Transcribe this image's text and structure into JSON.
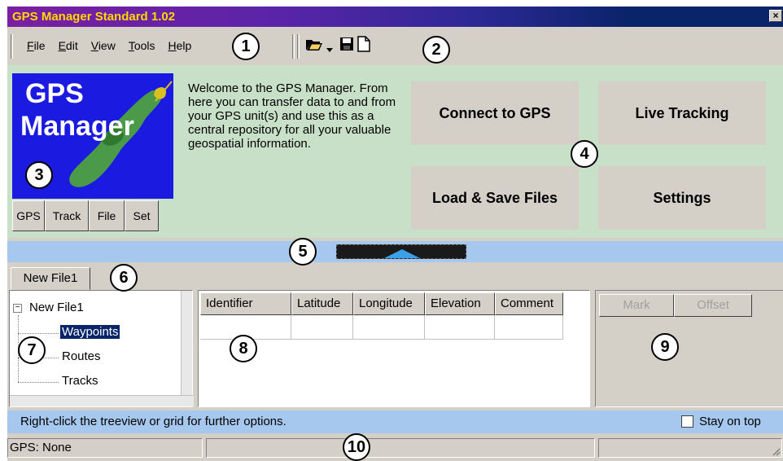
{
  "window": {
    "title": "GPS Manager Standard 1.02",
    "close_label": "×"
  },
  "menu": {
    "items": [
      {
        "label": "File",
        "accel": "F",
        "rest": "ile"
      },
      {
        "label": "Edit",
        "accel": "E",
        "rest": "dit"
      },
      {
        "label": "View",
        "accel": "V",
        "rest": "iew"
      },
      {
        "label": "Tools",
        "accel": "T",
        "rest": "ools"
      },
      {
        "label": "Help",
        "accel": "H",
        "rest": "elp"
      }
    ]
  },
  "toolbar": {
    "open_icon": "folder-open-icon",
    "dropdown_icon": "dropdown-arrow-icon",
    "save_icon": "floppy-disk-icon",
    "new_icon": "new-document-icon"
  },
  "logo": {
    "line1": "GPS",
    "line2": "Manager"
  },
  "quick_buttons": [
    "GPS",
    "Track",
    "File",
    "Set"
  ],
  "welcome_text": "Welcome to the GPS Manager. From here you can transfer data to and from your GPS unit(s) and use this as a central repository for all your valuable geospatial information.",
  "big_buttons": {
    "connect": "Connect to GPS",
    "live": "Live Tracking",
    "load_save": "Load & Save Files",
    "settings": "Settings"
  },
  "tab": {
    "label": "New File1"
  },
  "tree": {
    "root": "New File1",
    "expander": "−",
    "children": [
      "Waypoints",
      "Routes",
      "Tracks"
    ],
    "selected": "Waypoints"
  },
  "grid": {
    "columns": [
      "Identifier",
      "Latitude",
      "Longitude",
      "Elevation",
      "Comment"
    ]
  },
  "right_panel": {
    "mark": "Mark",
    "offset": "Offset"
  },
  "hint": {
    "text": "Right-click the treeview or grid for further options.",
    "stay_on_top": "Stay on top"
  },
  "status": {
    "gps": "GPS: None"
  },
  "callouts": [
    "1",
    "2",
    "3",
    "4",
    "5",
    "6",
    "7",
    "8",
    "9",
    "10"
  ],
  "colors": {
    "title_gradient_start": "#7a1fa2",
    "title_gradient_end": "#0a246a",
    "title_text": "#ffd700",
    "panel_green": "#c8e0c8",
    "splitter_blue": "#a6c8ee",
    "logo_blue": "#1a1ae0"
  }
}
